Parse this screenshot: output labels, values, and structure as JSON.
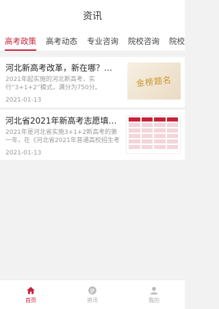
{
  "header": {
    "title": "资讯"
  },
  "tabs": [
    {
      "label": "高考政策",
      "active": true
    },
    {
      "label": "高考动态"
    },
    {
      "label": "专业咨询"
    },
    {
      "label": "院校咨询"
    },
    {
      "label": "院校咨"
    }
  ],
  "articles": [
    {
      "title": "河北新高考改革，新在哪？改...",
      "summary": "2021年起实施的河北新高考，实行“3+1+2”模式，满分为750分。",
      "date": "2021-01-13",
      "thumb_text": "金榜题名"
    },
    {
      "title": "河北省2021年新高考志愿填报...",
      "summary": "2021年是河北省实施3+1+2新高考的第一年，在《河北省2021年普通高校招生考试...",
      "date": "2021-01-13"
    }
  ],
  "tabbar": {
    "items": [
      {
        "label": "首页",
        "icon": "home-icon",
        "active": true
      },
      {
        "label": "资讯",
        "icon": "news-icon"
      },
      {
        "label": "我的",
        "icon": "user-icon"
      }
    ]
  },
  "colors": {
    "accent": "#c8233a",
    "muted": "#999999"
  }
}
